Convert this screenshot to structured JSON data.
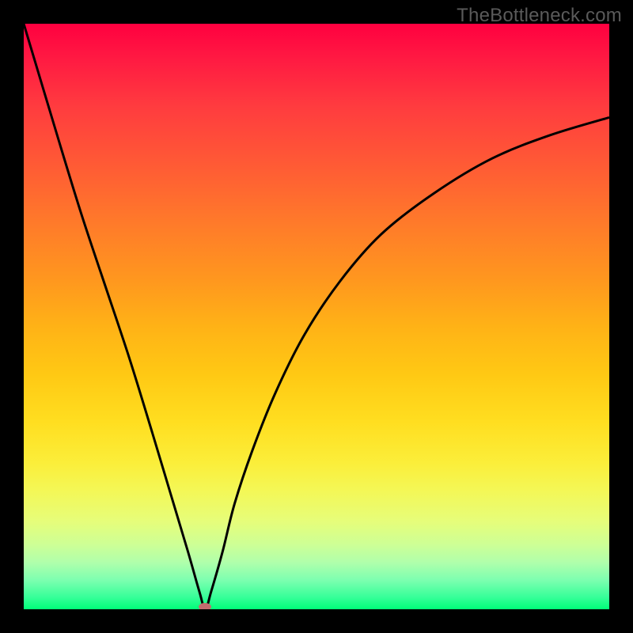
{
  "watermark": "TheBottleneck.com",
  "colors": {
    "frame": "#000000",
    "curve": "#000000",
    "min_marker": "#c46b6e"
  },
  "chart_data": {
    "type": "line",
    "title": "",
    "xlabel": "",
    "ylabel": "",
    "xlim": [
      0,
      100
    ],
    "ylim": [
      0,
      100
    ],
    "legend": false,
    "grid": false,
    "annotations": [
      "TheBottleneck.com"
    ],
    "min_point": {
      "x": 31,
      "y": 0
    },
    "series": [
      {
        "name": "bottleneck-curve",
        "x": [
          0,
          6,
          10,
          14,
          18,
          22,
          25,
          28,
          30,
          31,
          32,
          34,
          36,
          39,
          43,
          48,
          54,
          61,
          70,
          80,
          90,
          100
        ],
        "values": [
          100,
          80,
          67,
          55,
          43,
          30,
          20,
          10,
          3,
          0,
          3,
          10,
          18,
          27,
          37,
          47,
          56,
          64,
          71,
          77,
          81,
          84
        ]
      }
    ]
  }
}
